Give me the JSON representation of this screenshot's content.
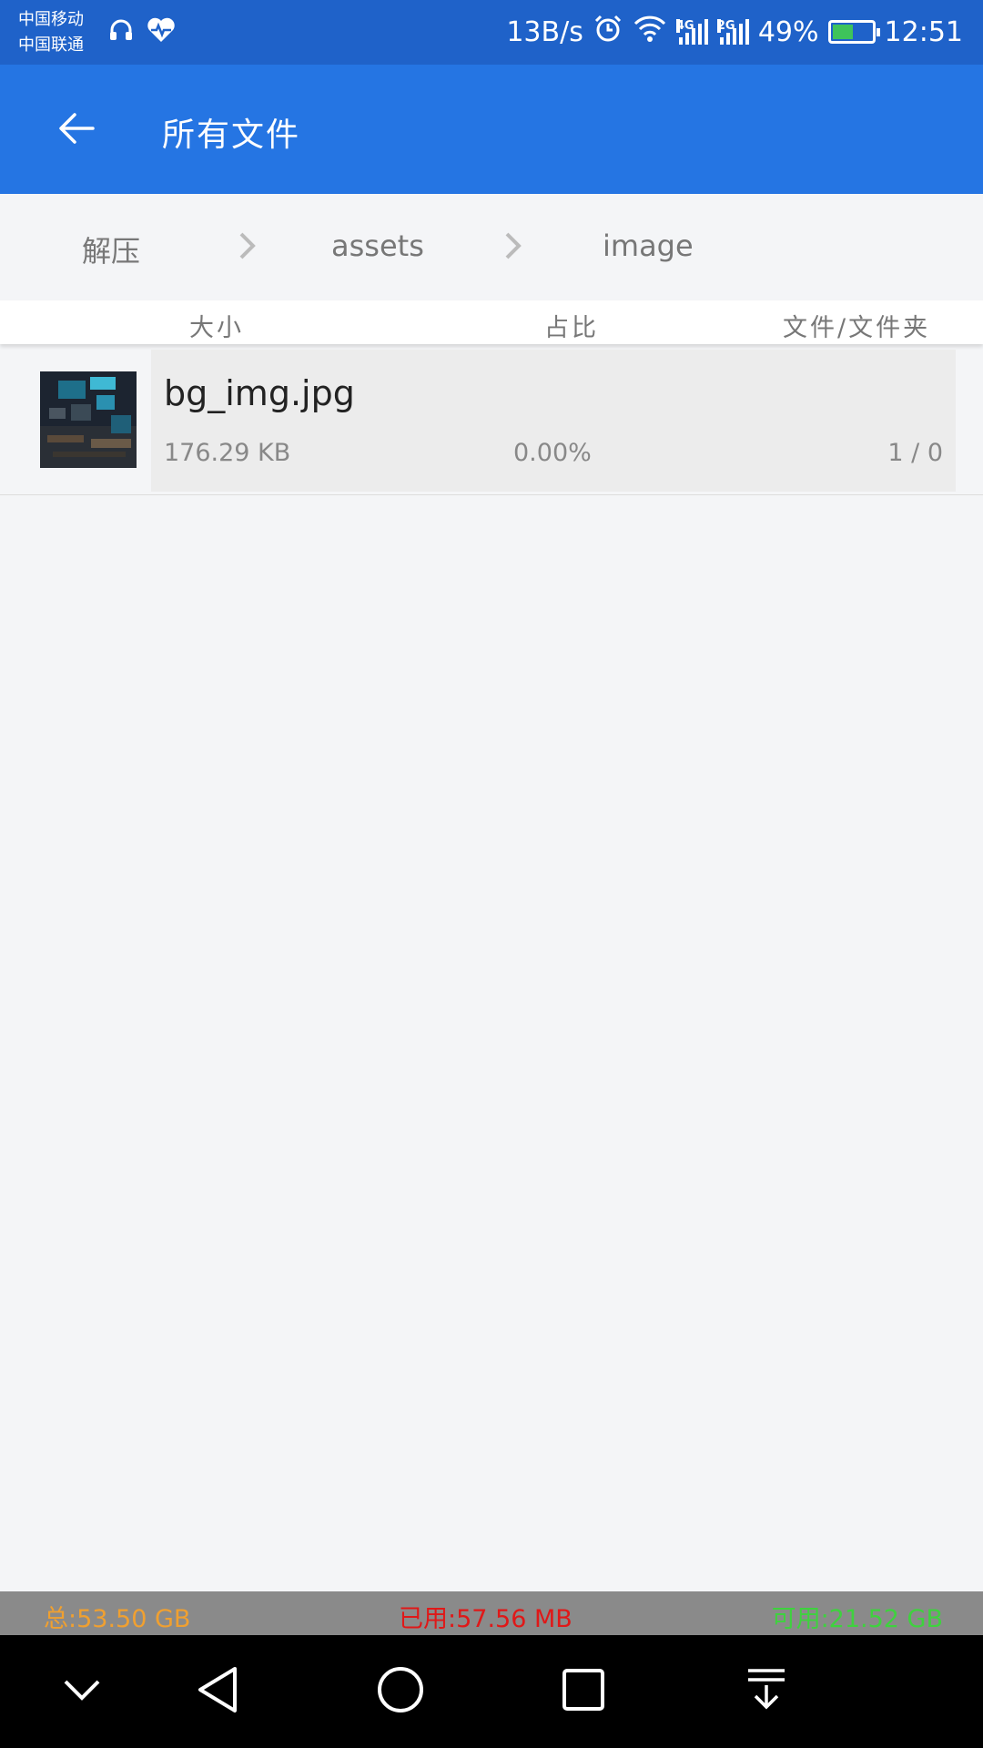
{
  "status_bar": {
    "carrier_1": "中国移动",
    "carrier_2": "中国联通",
    "net_speed": "13B/s",
    "sig1_label": "4G",
    "sig2_label": "2G",
    "battery_percent": "49%",
    "battery_level": 0.49,
    "time": "12:51",
    "icons": [
      "headset-icon",
      "health-icon",
      "alarm-icon",
      "wifi-icon",
      "signal-4g-icon",
      "signal-2g-icon",
      "battery-icon"
    ]
  },
  "app_bar": {
    "title": "所有文件",
    "back_icon": "back-arrow-icon"
  },
  "breadcrumb": {
    "items": [
      "解压",
      "assets",
      "image"
    ]
  },
  "columns": {
    "size": "大小",
    "ratio": "占比",
    "files_folders": "文件/文件夹"
  },
  "files": [
    {
      "name": "bg_img.jpg",
      "size": "176.29 KB",
      "ratio": "0.00%",
      "count": "1 / 0"
    }
  ],
  "storage": {
    "total": "总:53.50 GB",
    "used": "已用:57.56 MB",
    "available": "可用:21.52 GB",
    "colors": {
      "total": "#f0a030",
      "used": "#e01818",
      "available": "#3ed23e"
    }
  },
  "nav_bar": {
    "icons": [
      "collapse-icon",
      "back-icon",
      "home-icon",
      "recents-icon",
      "notification-pull-icon"
    ]
  },
  "colors": {
    "status_bar": "#1f62c9",
    "app_bar": "#2575e3",
    "background": "#f4f5f7"
  }
}
